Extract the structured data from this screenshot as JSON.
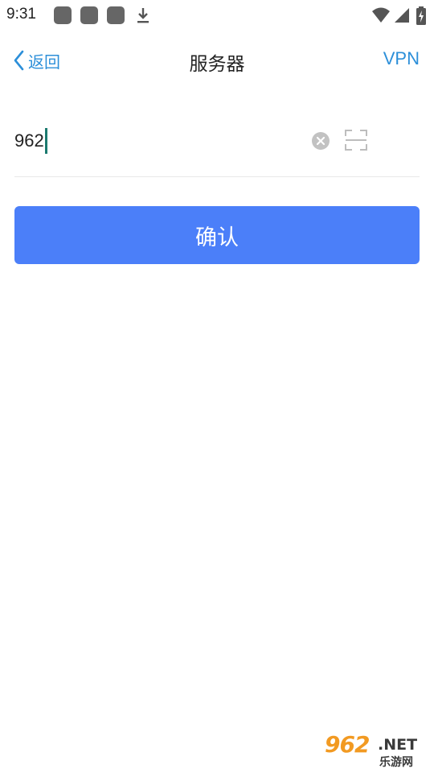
{
  "status_bar": {
    "time": "9:31",
    "icons": [
      "notification-icon",
      "notification-icon",
      "notification-icon",
      "download-icon",
      "wifi-icon",
      "signal-icon",
      "battery-charging-icon"
    ]
  },
  "header": {
    "back_label": "返回",
    "title": "服务器",
    "vpn_label": "VPN"
  },
  "server_input": {
    "value": "962"
  },
  "confirm_button": {
    "label": "确认",
    "color": "#4b7ff9"
  },
  "watermark": {
    "number": "962",
    "domain": ".NET",
    "subtitle": "乐游网"
  },
  "colors": {
    "accent": "#2c8fd9",
    "caret": "#1b7a6f"
  }
}
